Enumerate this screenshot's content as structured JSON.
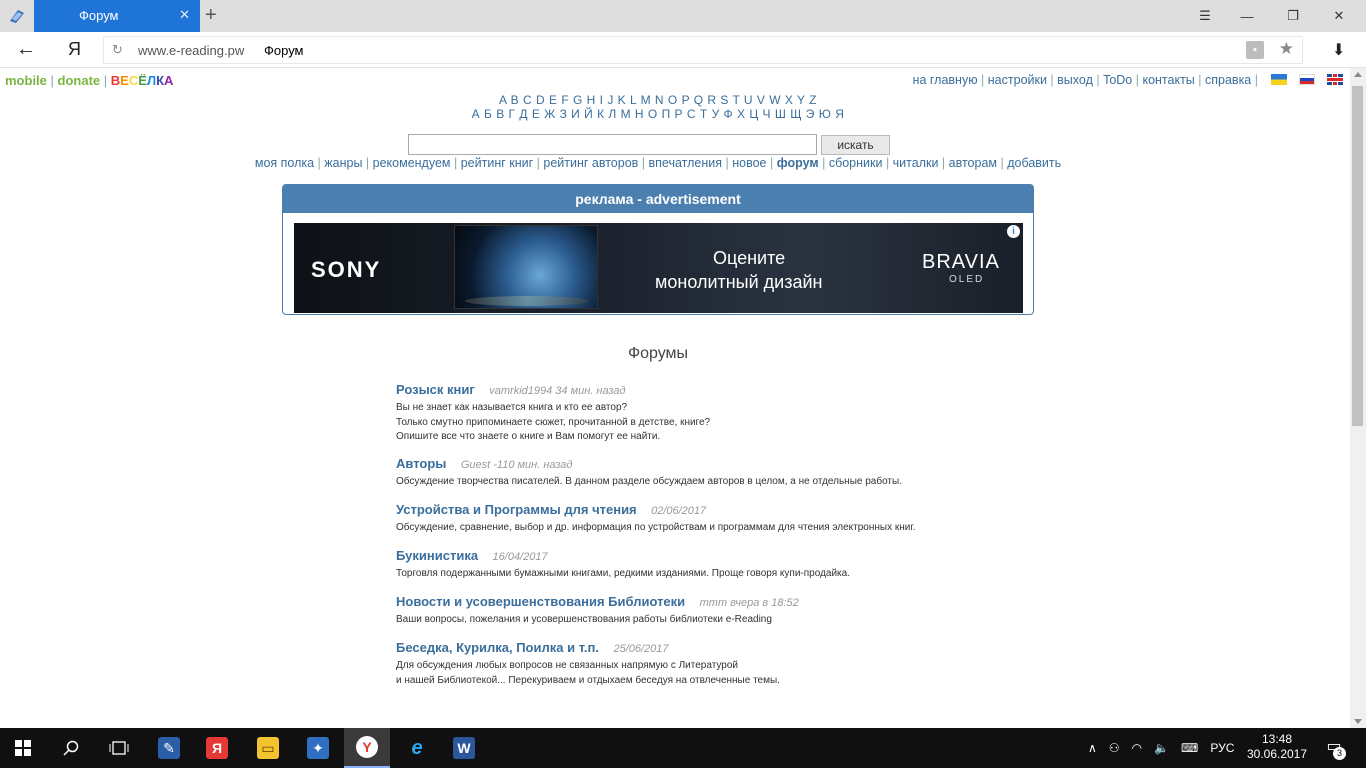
{
  "browser": {
    "tab_title": "Форум",
    "url": "www.e-reading.pw",
    "url_page_title": "Форум"
  },
  "page": {
    "top_left": {
      "mobile": "mobile",
      "donate": "donate",
      "vesyolka": [
        "В",
        "Е",
        "С",
        "Ё",
        "Л",
        "К",
        "А"
      ],
      "vesyolka_colors": [
        "#e53935",
        "#fb8c00",
        "#fdd835",
        "#43a047",
        "#1e88e5",
        "#3949ab",
        "#8e24aa"
      ]
    },
    "top_right": [
      "на главную",
      "настройки",
      "выход",
      "ToDo",
      "контакты",
      "справка"
    ],
    "alphabet_latin": "A B C D E F G H I J K L M N O P Q R S T U V W X Y Z",
    "alphabet_cyrillic": "А Б В Г Д Е Ж З И Й К Л М Н О П Р С Т У Ф Х Ц Ч Ш Щ Э Ю Я",
    "search": {
      "value": "",
      "button": "искать"
    },
    "nav": [
      "моя полка",
      "жанры",
      "рекомендуем",
      "рейтинг книг",
      "рейтинг авторов",
      "впечатления",
      "новое",
      "форум",
      "сборники",
      "читалки",
      "авторам",
      "добавить"
    ],
    "nav_active": "форум",
    "ad": {
      "header": "реклама - advertisement",
      "brand": "SONY",
      "line1": "Оцените",
      "line2": "монолитный дизайн",
      "product": "BRAVIA",
      "product_sub": "OLED",
      "info_icon": "i"
    },
    "forums_title": "Форумы",
    "forums": [
      {
        "name": "Розыск книг",
        "meta": "vamrkid1994 34 мин. назад",
        "desc": [
          "Вы не знает как называется книга и кто ее автор?",
          "Только смутно припоминаете сюжет, прочитанной в детстве, книге?",
          "Опишите все что знаете о книге и Вам помогут ее найти."
        ]
      },
      {
        "name": "Авторы",
        "meta": "Guest -110 мин. назад",
        "desc": [
          "Обсуждение творчества писателей. В данном разделе обсуждаем авторов в целом, а не отдельные работы."
        ]
      },
      {
        "name": "Устройства и Программы для чтения",
        "meta": "02/06/2017",
        "desc": [
          "Обсуждение, сравнение, выбор и др. информация по устройствам и программам для чтения электронных книг."
        ]
      },
      {
        "name": "Букинистика",
        "meta": "16/04/2017",
        "desc": [
          "Торговля подержанными бумажными книгами, редкими изданиями. Проще говоря купи-продайка."
        ]
      },
      {
        "name": "Новости и усовершенствования Библиотеки",
        "meta": "mmm вчера в 18:52",
        "desc": [
          "Ваши вопросы, пожелания и усовершенствования работы библиотеки e-Reading"
        ]
      },
      {
        "name": "Беседка, Курилка, Поилка и т.п.",
        "meta": "25/06/2017",
        "desc": [
          "Для обсуждения любых вопросов не связанных напрямую с Литературой",
          "и нашей Библиотекой... Перекуриваем и отдыхаем беседуя на отвлеченные темы."
        ]
      }
    ]
  },
  "taskbar": {
    "language": "РУС",
    "time": "13:48",
    "date": "30.06.2017",
    "notifications": "3"
  }
}
